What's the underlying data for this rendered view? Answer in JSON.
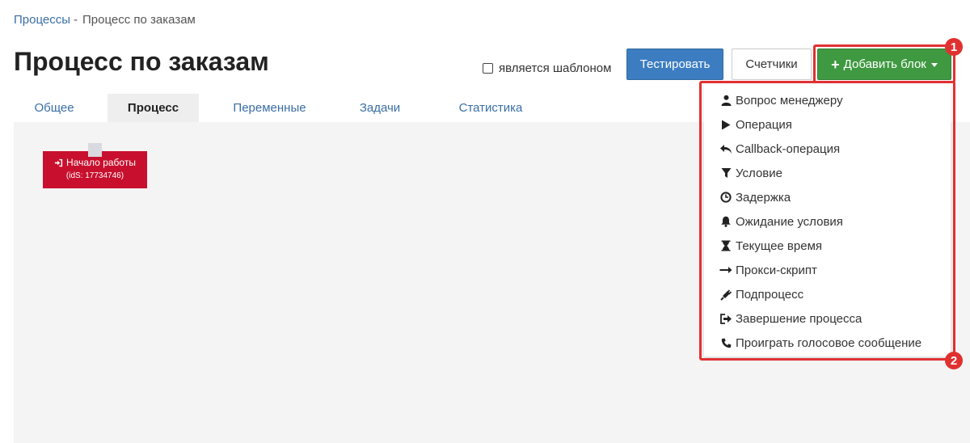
{
  "breadcrumb": {
    "parent": "Процессы",
    "separator": "-",
    "current": "Процесс по заказам"
  },
  "page": {
    "title": "Процесс по заказам"
  },
  "header": {
    "template_checkbox_label": "является шаблоном",
    "template_checked": false,
    "test_button": "Тестировать",
    "counters_button": "Счетчики",
    "add_block_button": "Добавить блок"
  },
  "tabs": [
    {
      "label": "Общее",
      "active": false
    },
    {
      "label": "Процесс",
      "active": true
    },
    {
      "label": "Переменные",
      "active": false
    },
    {
      "label": "Задачи",
      "active": false
    },
    {
      "label": "Статистика",
      "active": false
    }
  ],
  "canvas": {
    "start_block": {
      "title": "Начало работы",
      "ids": "(idS: 17734746)"
    }
  },
  "add_block_menu": [
    {
      "label": "Вопрос менеджеру",
      "icon": "user-icon"
    },
    {
      "label": "Операция",
      "icon": "play-icon"
    },
    {
      "label": "Callback-операция",
      "icon": "reply-icon"
    },
    {
      "label": "Условие",
      "icon": "filter-icon"
    },
    {
      "label": "Задержка",
      "icon": "clock-icon"
    },
    {
      "label": "Ожидание условия",
      "icon": "bell-icon"
    },
    {
      "label": "Текущее время",
      "icon": "hourglass-icon"
    },
    {
      "label": "Прокси-скрипт",
      "icon": "arrow-right-icon"
    },
    {
      "label": "Подпроцесс",
      "icon": "plug-icon"
    },
    {
      "label": "Завершение процесса",
      "icon": "sign-out-icon"
    },
    {
      "label": "Проиграть голосовое сообщение",
      "icon": "phone-icon"
    }
  ],
  "annotations": {
    "marker_1": "1",
    "marker_2": "2"
  },
  "colors": {
    "primary": "#3c7dc1",
    "success": "#3f9941",
    "start_block": "#c8102e",
    "annotation": "#e03131",
    "link": "#3a6ea5"
  }
}
